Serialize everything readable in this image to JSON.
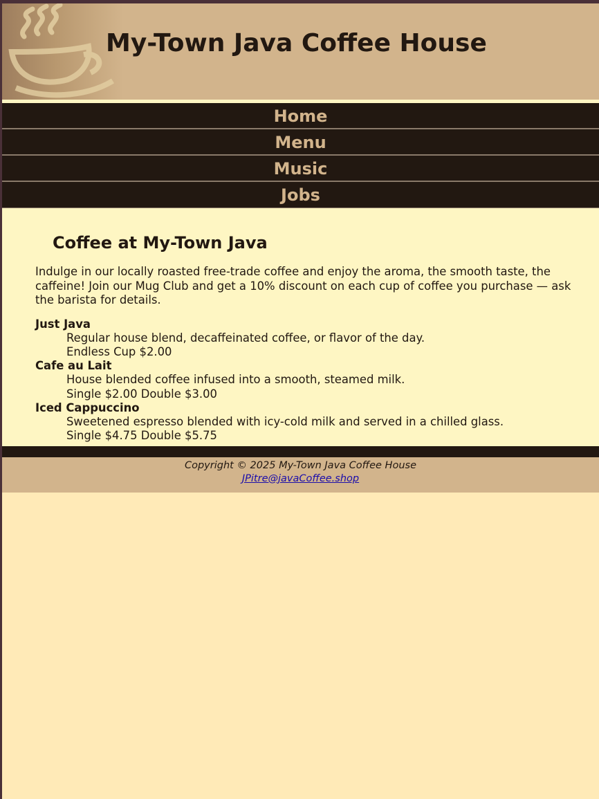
{
  "header": {
    "title": "My-Town Java Coffee House",
    "logo_icon": "coffee-cup-icon"
  },
  "nav": {
    "items": [
      {
        "label": "Home"
      },
      {
        "label": "Menu"
      },
      {
        "label": "Music"
      },
      {
        "label": "Jobs"
      }
    ]
  },
  "main": {
    "heading": "Coffee at My-Town Java",
    "intro": "Indulge in our locally roasted free-trade coffee and enjoy the aroma, the smooth taste, the caffeine! Join our Mug Club and get a 10% discount on each cup of coffee you purchase — ask the barista for details.",
    "menu": [
      {
        "name": "Just Java",
        "description": "Regular house blend, decaffeinated coffee, or flavor of the day.",
        "price": "Endless Cup $2.00"
      },
      {
        "name": "Cafe au Lait",
        "description": "House blended coffee infused into a smooth, steamed milk.",
        "price": "Single $2.00 Double $3.00"
      },
      {
        "name": "Iced Cappuccino",
        "description": "Sweetened espresso blended with icy-cold milk and served in a chilled glass.",
        "price": "Single $4.75 Double $5.75"
      }
    ]
  },
  "footer": {
    "copyright": "Copyright © 2025 My-Town Java Coffee House",
    "email": "JPitre@javaCoffee.shop"
  },
  "colors": {
    "dark_brown": "#221811",
    "tan": "#d2b48c",
    "cream": "#fef6c3",
    "page_bg": "#ffeab7",
    "frame": "#4a3038"
  }
}
